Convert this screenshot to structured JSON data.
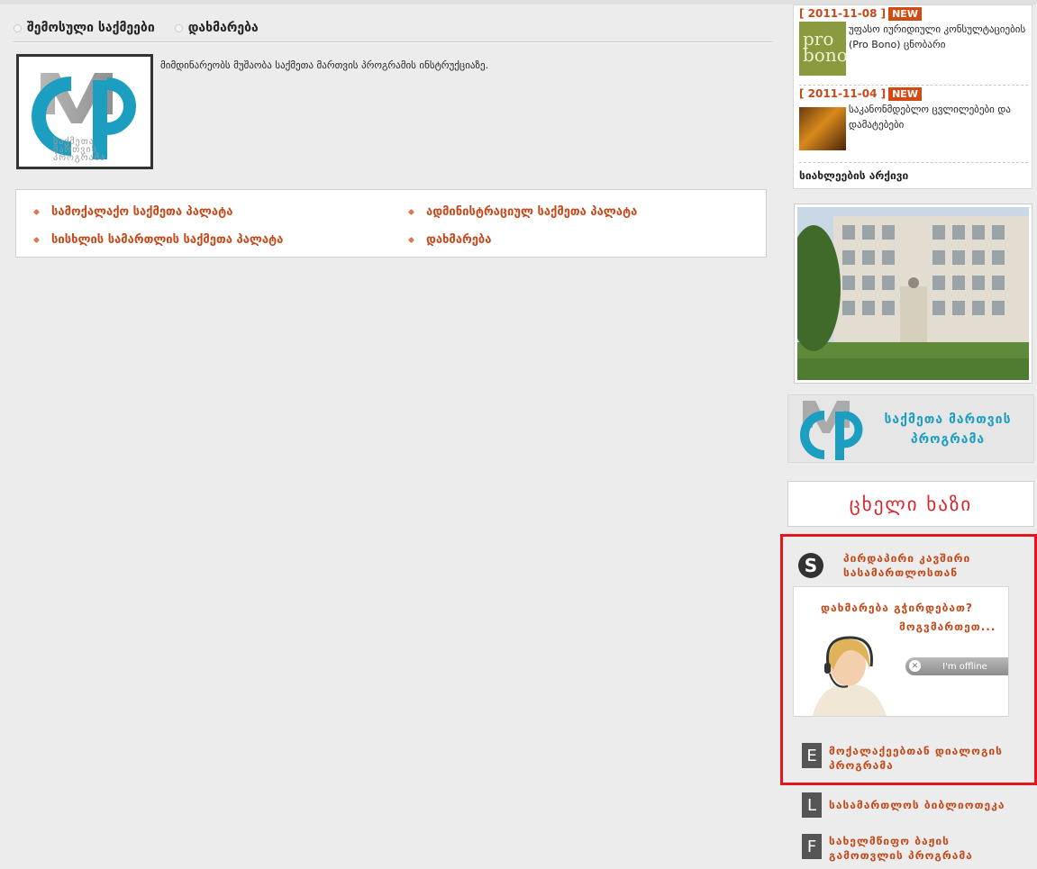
{
  "nav": {
    "items": [
      {
        "label": "შემოსული საქმეები"
      },
      {
        "label": "დახმარება"
      }
    ]
  },
  "intro": {
    "logo_lines": [
      "საქმეთა",
      "მართვის",
      "პროგრამა"
    ],
    "text": "მიმდინარეობს მუშაობა საქმეთა მართვის პროგრამის ინსტრუქციაზე."
  },
  "links": {
    "civil": "სამოქალაქო საქმეთა პალატა",
    "admin": "ადმინისტრაციულ საქმეთა პალატა",
    "criminal": "სისხლის სამართლის საქმეთა პალატა",
    "help": "დახმარება"
  },
  "news": {
    "items": [
      {
        "date": "[ 2011-11-08 ]",
        "badge": "NEW",
        "title": "უფასო იურიდიული კონსულტაციების (Pro Bono) ცნობარი",
        "thumb_text": "pro bono"
      },
      {
        "date": "[ 2011-11-04 ]",
        "badge": "NEW",
        "title": "საკანონმდებლო ცვლილებები და დამატებები"
      }
    ],
    "archive": "სიახლეების არქივი"
  },
  "banners": {
    "cmp_line1": "საქმეთა მართვის",
    "cmp_line2": "პროგრამა",
    "hotline": "ცხელი ხაზი"
  },
  "skype": {
    "line1": "პირდაპირი კავშირი",
    "line2": "სასამართლოსთან",
    "help_q": "დახმარება გჭირდებათ?",
    "help_call": "მოგვმართეთ...",
    "status": "I'm offline"
  },
  "programs": [
    {
      "letter": "E",
      "line1": "მოქალაქეებთან დიალოგის",
      "line2": "პროგრამა"
    },
    {
      "letter": "L",
      "line1": "სასამართლოს ბიბლიოთეკა",
      "line2": ""
    },
    {
      "letter": "F",
      "line1": "სახელმწიფო ბაჟის",
      "line2": "გამოთვლის პროგრამა"
    }
  ],
  "colors": {
    "accent": "#c4491a",
    "badge": "#d34a12",
    "hotline": "#d8252b",
    "highlight": "#e4161d",
    "cmp_blue": "#1c9ec1"
  }
}
